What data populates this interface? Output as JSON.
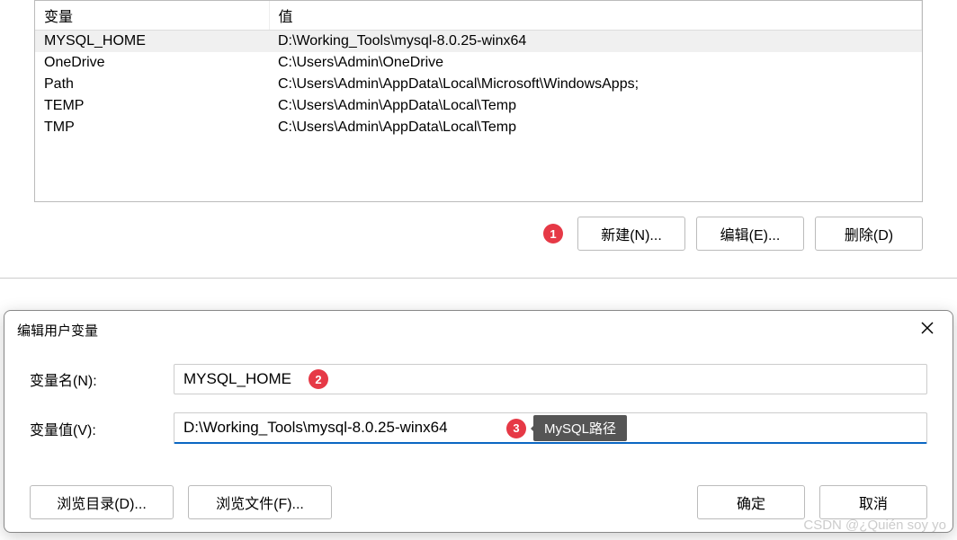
{
  "table": {
    "headers": {
      "variable": "变量",
      "value": "值"
    },
    "rows": [
      {
        "name": "MYSQL_HOME",
        "value": "D:\\Working_Tools\\mysql-8.0.25-winx64",
        "selected": true
      },
      {
        "name": "OneDrive",
        "value": "C:\\Users\\Admin\\OneDrive",
        "selected": false
      },
      {
        "name": "Path",
        "value": "C:\\Users\\Admin\\AppData\\Local\\Microsoft\\WindowsApps;",
        "selected": false
      },
      {
        "name": "TEMP",
        "value": "C:\\Users\\Admin\\AppData\\Local\\Temp",
        "selected": false
      },
      {
        "name": "TMP",
        "value": "C:\\Users\\Admin\\AppData\\Local\\Temp",
        "selected": false
      }
    ]
  },
  "buttons": {
    "new": "新建(N)...",
    "edit": "编辑(E)...",
    "delete": "删除(D)"
  },
  "annotations": {
    "badge1": "1",
    "badge2": "2",
    "badge3": "3",
    "tooltip": "MySQL路径"
  },
  "dialog": {
    "title": "编辑用户变量",
    "name_label": "变量名(N):",
    "name_value": "MYSQL_HOME",
    "value_label": "变量值(V):",
    "value_value": "D:\\Working_Tools\\mysql-8.0.25-winx64",
    "browse_dir": "浏览目录(D)...",
    "browse_file": "浏览文件(F)...",
    "ok": "确定",
    "cancel": "取消"
  },
  "watermark": "CSDN @¿Quién soy yo"
}
